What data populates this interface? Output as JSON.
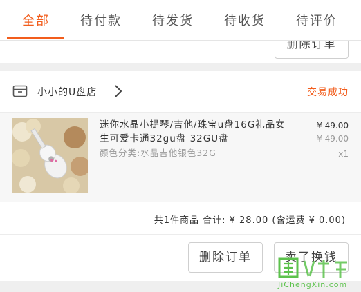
{
  "tabs": [
    {
      "label": "全部",
      "active": true
    },
    {
      "label": "待付款",
      "active": false
    },
    {
      "label": "待发货",
      "active": false
    },
    {
      "label": "待收货",
      "active": false
    },
    {
      "label": "待评价",
      "active": false
    }
  ],
  "prev_order": {
    "delete_label": "删除订单"
  },
  "order": {
    "shop_name": "小小的U盘店",
    "status": "交易成功",
    "item": {
      "title": "迷你水晶小提琴/吉他/珠宝u盘16G礼品女生可爱卡通32gu盘 32GU盘",
      "variant": "颜色分类:水晶吉他银色32G",
      "price": "¥ 49.00",
      "original_price": "¥ 49.00",
      "quantity": "x1"
    },
    "summary": "共1件商品  合计: ¥ 28.00 (含运费 ¥ 0.00)",
    "buttons": {
      "delete_label": "删除订单",
      "sell_label": "卖了换钱"
    }
  },
  "watermark": {
    "text": "JiChengXin.com"
  },
  "colors": {
    "accent": "#f25d1c",
    "watermark": "#5cc24c"
  }
}
